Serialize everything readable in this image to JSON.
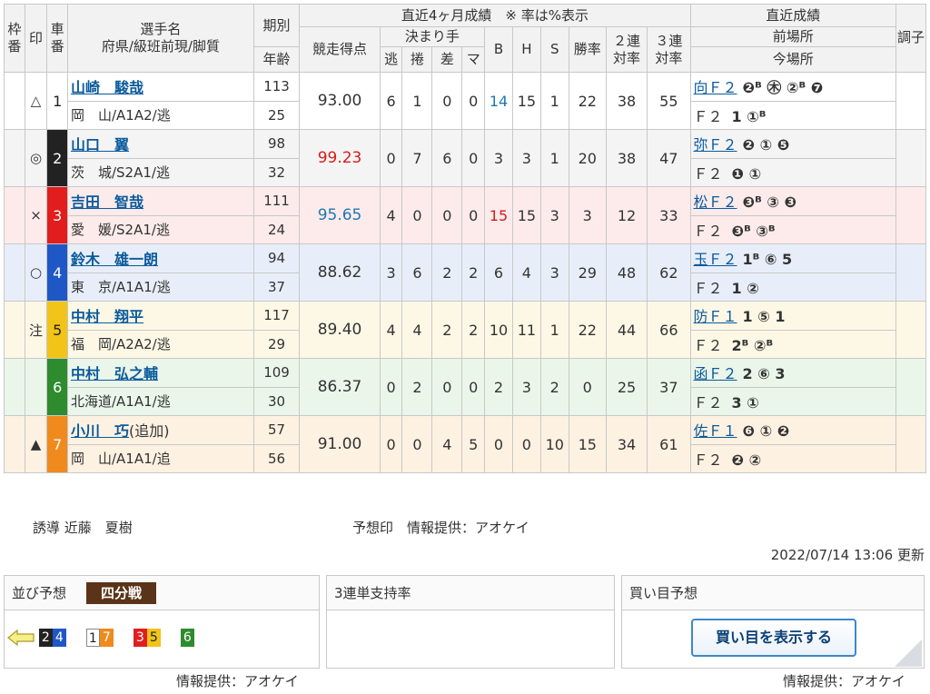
{
  "headers": {
    "waku": "枠番",
    "shirushi": "印",
    "sha": "車番",
    "rider_name": "選手名",
    "rider_sub": "府県/級班前現/脚質",
    "kibetsu": "期別",
    "nenrei": "年齢",
    "recent4": "直近4ヶ月成績　※ 率は%表示",
    "score": "競走得点",
    "kimarite": "決まり手",
    "nige": "逃",
    "makuri": "捲",
    "sashi": "差",
    "mark": "マ",
    "b": "B",
    "h": "H",
    "s": "S",
    "win": "勝率",
    "ren2a": "２連",
    "ren2b": "対率",
    "ren3a": "３連",
    "ren3b": "対率",
    "recent": "直近成績",
    "prev": "前場所",
    "curr": "今場所",
    "cond": "調子"
  },
  "riders": [
    {
      "mark": "△",
      "car": "1",
      "name": "山崎　駿哉",
      "suffix": "",
      "pref": "岡　山/A1A2/逃",
      "period": "113",
      "age": "25",
      "score": "93.00",
      "score_color": "",
      "nige": "6",
      "makuri": "1",
      "sashi": "0",
      "mark_c": "0",
      "b": "14",
      "b_color": "blue",
      "h": "15",
      "s": "1",
      "win": "22",
      "r2": "38",
      "r3": "55",
      "prev_venue": "向Ｆ２",
      "prev_res": "❷ᴮ ㊍ ②ᴮ ❼",
      "curr_venue": "Ｆ２",
      "curr_res": "1 ①ᴮ"
    },
    {
      "mark": "◎",
      "car": "2",
      "name": "山口　翼",
      "suffix": "",
      "pref": "茨　城/S2A1/逃",
      "period": "98",
      "age": "32",
      "score": "99.23",
      "score_color": "red",
      "nige": "0",
      "makuri": "7",
      "sashi": "6",
      "mark_c": "0",
      "b": "3",
      "b_color": "",
      "h": "3",
      "s": "1",
      "win": "20",
      "r2": "38",
      "r3": "47",
      "prev_venue": "弥Ｆ２",
      "prev_res": "❷ ① ❺",
      "curr_venue": "Ｆ２",
      "curr_res": "❶ ①"
    },
    {
      "mark": "×",
      "car": "3",
      "name": "吉田　智哉",
      "suffix": "",
      "pref": "愛　媛/S2A1/逃",
      "period": "111",
      "age": "24",
      "score": "95.65",
      "score_color": "blue",
      "nige": "4",
      "makuri": "0",
      "sashi": "0",
      "mark_c": "0",
      "b": "15",
      "b_color": "red",
      "h": "15",
      "s": "3",
      "win": "3",
      "r2": "12",
      "r3": "33",
      "prev_venue": "松Ｆ２",
      "prev_res": "❸ᴮ ③ ❸",
      "curr_venue": "Ｆ２",
      "curr_res": "❸ᴮ ③ᴮ"
    },
    {
      "mark": "○",
      "car": "4",
      "name": "鈴木　雄一朗",
      "suffix": "",
      "pref": "東　京/A1A1/逃",
      "period": "94",
      "age": "37",
      "score": "88.62",
      "score_color": "",
      "nige": "3",
      "makuri": "6",
      "sashi": "2",
      "mark_c": "2",
      "b": "6",
      "b_color": "",
      "h": "4",
      "s": "3",
      "win": "29",
      "r2": "48",
      "r3": "62",
      "prev_venue": "玉Ｆ２",
      "prev_res": "1ᴮ ⑥ 5",
      "curr_venue": "Ｆ２",
      "curr_res": "1 ②"
    },
    {
      "mark": "注",
      "car": "5",
      "name": "中村　翔平",
      "suffix": "",
      "pref": "福　岡/A2A2/逃",
      "period": "117",
      "age": "29",
      "score": "89.40",
      "score_color": "",
      "nige": "4",
      "makuri": "4",
      "sashi": "2",
      "mark_c": "2",
      "b": "10",
      "b_color": "",
      "h": "11",
      "s": "1",
      "win": "22",
      "r2": "44",
      "r3": "66",
      "prev_venue": "防Ｆ１",
      "prev_res": "1 ⑤ 1",
      "curr_venue": "Ｆ２",
      "curr_res": "2ᴮ ②ᴮ"
    },
    {
      "mark": "",
      "car": "6",
      "name": "中村　弘之輔",
      "suffix": "",
      "pref": "北海道/A1A1/逃",
      "period": "109",
      "age": "30",
      "score": "86.37",
      "score_color": "",
      "nige": "0",
      "makuri": "2",
      "sashi": "0",
      "mark_c": "0",
      "b": "2",
      "b_color": "",
      "h": "3",
      "s": "2",
      "win": "0",
      "r2": "25",
      "r3": "37",
      "prev_venue": "函Ｆ２",
      "prev_res": "2 ⑥ 3",
      "curr_venue": "Ｆ２",
      "curr_res": "3 ①"
    },
    {
      "mark": "▲",
      "car": "7",
      "name": "小川　巧",
      "suffix": "(追加)",
      "pref": "岡　山/A1A1/追",
      "period": "57",
      "age": "56",
      "score": "91.00",
      "score_color": "",
      "nige": "0",
      "makuri": "0",
      "sashi": "4",
      "mark_c": "5",
      "b": "0",
      "b_color": "",
      "h": "0",
      "s": "10",
      "win": "15",
      "r2": "34",
      "r3": "61",
      "prev_venue": "佐Ｆ１",
      "prev_res": "❻ ① ❷",
      "curr_venue": "Ｆ２",
      "curr_res": "❷ ②"
    }
  ],
  "footer": {
    "lead": "誘導 近藤　夏樹",
    "prediction_source": "予想印　情報提供：アオケイ",
    "updated": "2022/07/14 13:06 更新"
  },
  "panels": {
    "line_title": "並び予想",
    "line_tag": "四分戦",
    "support_title": "3連単支持率",
    "buy_title": "買い目予想",
    "buy_button": "買い目を表示する",
    "credit_left": "情報提供：アオケイ",
    "credit_right": "情報提供：アオケイ",
    "line_groups": [
      [
        "2",
        "4"
      ],
      [
        "1",
        "7"
      ],
      [
        "3",
        "5"
      ],
      [
        "6"
      ]
    ]
  }
}
